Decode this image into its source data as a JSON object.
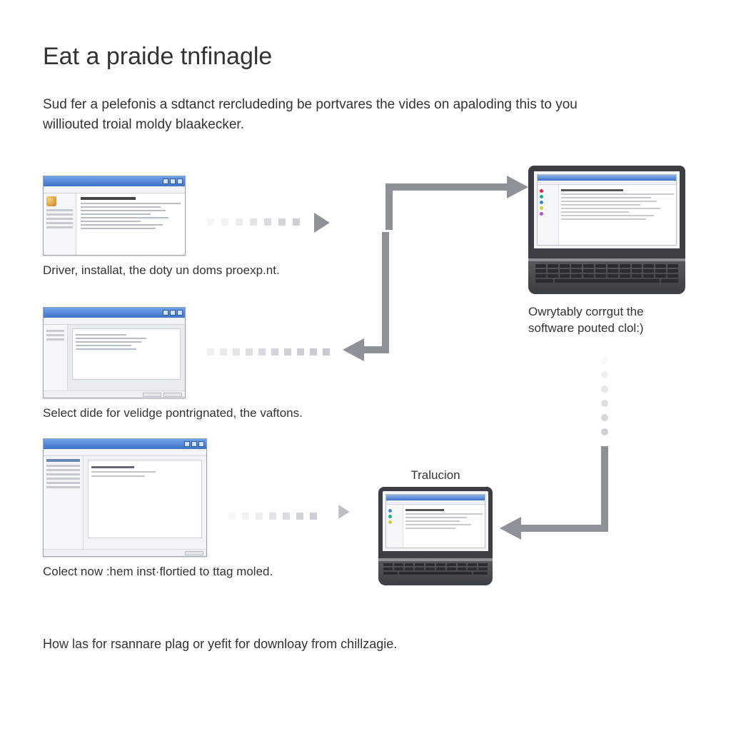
{
  "title": "Eat a praide tnfinagle",
  "intro": "Sud fer a pelefonis a sdtanct rercludeding be portvares the vides on apaloding this to you williouted troial moldy blaakecker.",
  "steps": {
    "step1_caption": "Driver, installat, the doty un doms proexp.nt.",
    "step2_caption": "Select dide for velidge pontrignated, the vaftons.",
    "step3_caption": "Colect now :hem inst·flortied to ttag moled."
  },
  "laptop_big_caption": "Owrytably corrgut the software pouted clol:)",
  "laptop_small_label": "Tralucion",
  "footer": "How las for rsannare plag or yefit for downloay from chillzagie."
}
